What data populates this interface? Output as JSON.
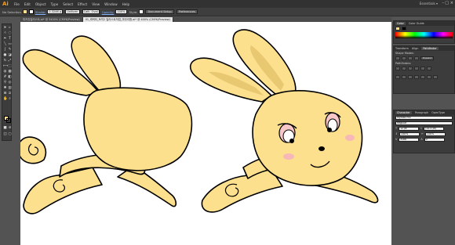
{
  "app": {
    "logo": "Ai",
    "workspace": "Essentials ▾"
  },
  "menu": [
    "File",
    "Edit",
    "Object",
    "Type",
    "Select",
    "Effect",
    "View",
    "Window",
    "Help"
  ],
  "control_bar": {
    "selection": "No Selection",
    "stroke_label": "Stroke:",
    "stroke_value": "0.3246 p",
    "profile": "Uniform",
    "brush": "Calli. Oval",
    "opacity_label": "Opacity:",
    "opacity_value": "100%",
    "style_label": "Style:",
    "document_setup": "Document Setup",
    "preferences": "Preferences"
  },
  "tabs": [
    {
      "label": "피카츄일러스트.ai* @ 3400% (CMYK/Preview)",
      "active": false
    },
    {
      "label": "01_캐릭터_토끼2 일러스트작업_마무리함.ai* @ 400% (CMYK/Preview)",
      "active": true
    }
  ],
  "panels": {
    "color": {
      "tabs": [
        "Color",
        "Color Guide"
      ]
    },
    "pathfinder": {
      "tabs": [
        "Transform",
        "Align",
        "Pathfinder"
      ],
      "shape_modes_label": "Shape Modes:",
      "pathfinders_label": "Pathfinders:",
      "expand_label": "Expand"
    },
    "character": {
      "tabs": [
        "Character",
        "Paragraph",
        "OpenType"
      ],
      "font": "Myriad Pro",
      "style": "Regular",
      "size": "12 pt",
      "leading": "(14.4 pt)",
      "scale_h": "100%",
      "scale_v": "100%",
      "kerning": "Auto",
      "tracking": "0"
    }
  },
  "colors": {
    "fill": "#ffde8a",
    "bunny_fill": "#fde08e",
    "ear_inner": "#e8c871",
    "cheek": "#f7b0c0",
    "accent": "#f39c1e"
  }
}
